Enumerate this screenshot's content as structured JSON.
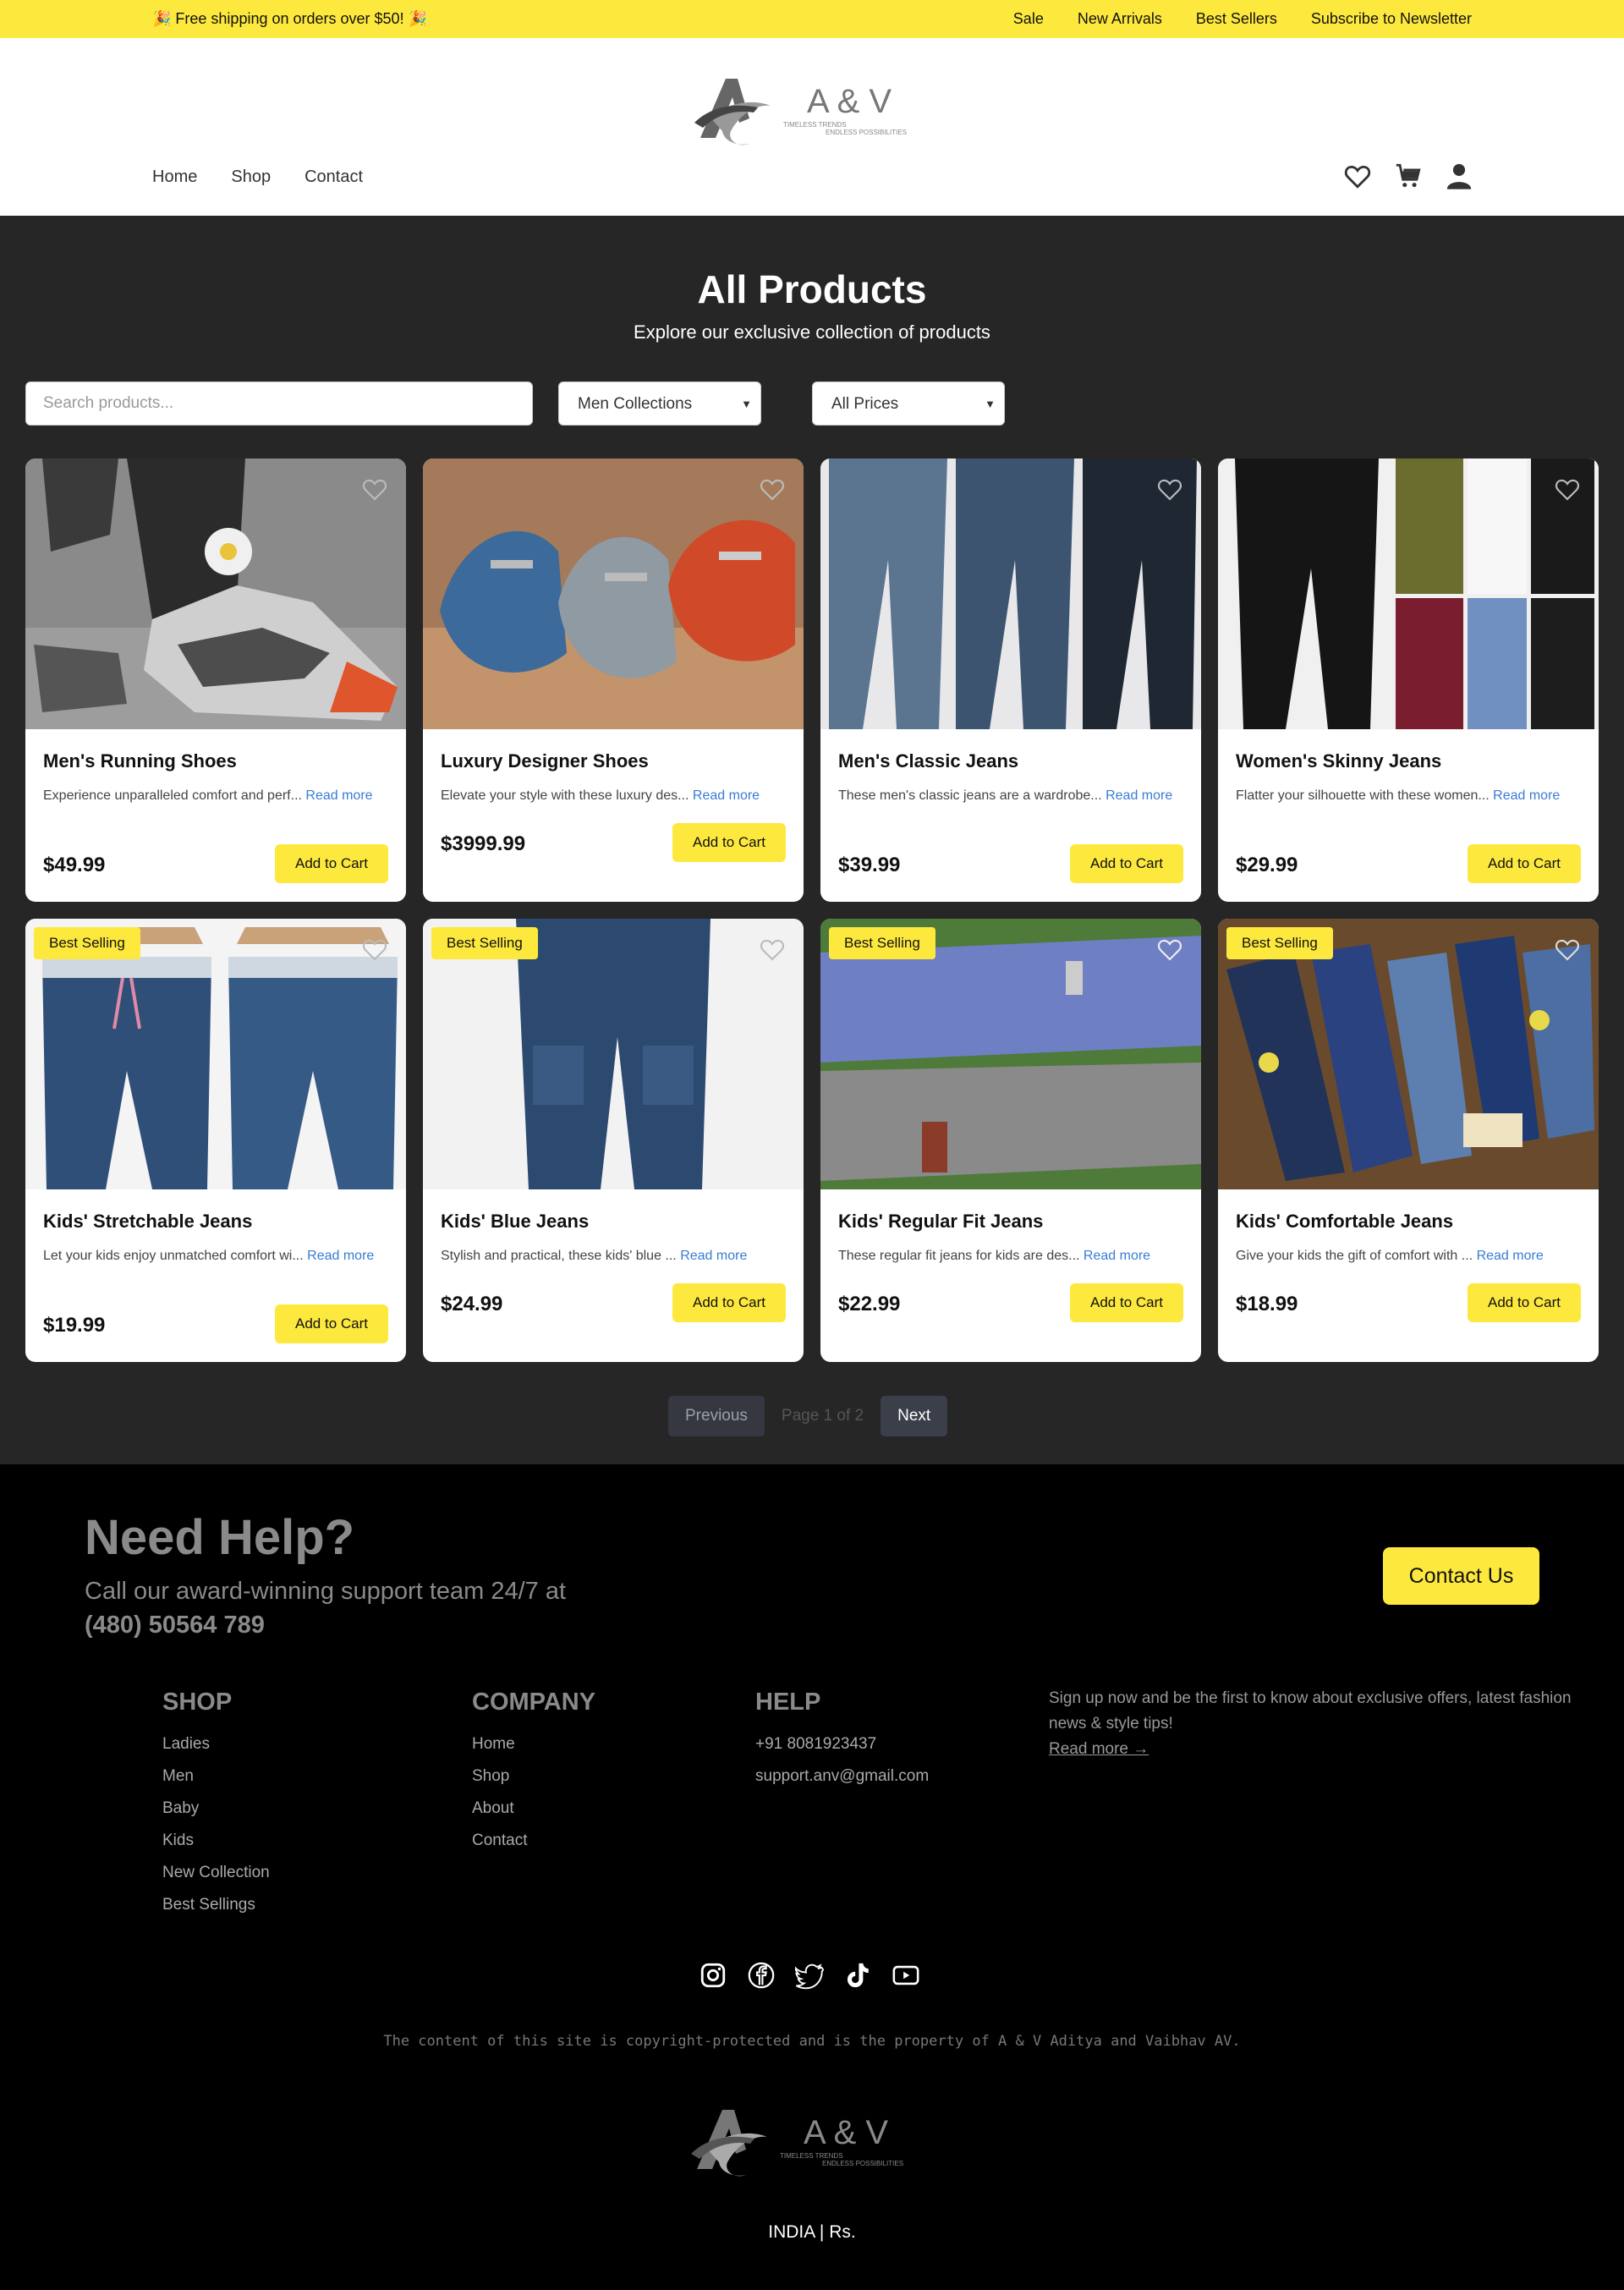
{
  "topbar": {
    "promo": "🎉 Free shipping on orders over $50! 🎉",
    "links": [
      "Sale",
      "New Arrivals",
      "Best Sellers",
      "Subscribe to Newsletter"
    ]
  },
  "header": {
    "logo_text": "A & V",
    "logo_tagline_1": "TIMELESS TRENDS",
    "logo_tagline_2": "ENDLESS POSSIBILITIES",
    "nav": [
      "Home",
      "Shop",
      "Contact"
    ],
    "icons": [
      "heart-icon",
      "cart-icon",
      "user-icon"
    ]
  },
  "main": {
    "title": "All Products",
    "subtitle": "Explore our exclusive collection of products",
    "search_placeholder": "Search products...",
    "category_filter": "Men Collections",
    "price_filter": "All Prices",
    "add_to_cart_label": "Add to Cart",
    "read_more_label": "Read more",
    "badge_label": "Best Selling",
    "products": [
      {
        "name": "Men's Running Shoes",
        "desc": "Experience unparalleled comfort and perf...",
        "price": "$49.99",
        "badge": false
      },
      {
        "name": "Luxury Designer Shoes",
        "desc": "Elevate your style with these luxury des...",
        "price": "$3999.99",
        "badge": false
      },
      {
        "name": "Men's Classic Jeans",
        "desc": "These men's classic jeans are a wardrobe...",
        "price": "$39.99",
        "badge": false
      },
      {
        "name": "Women's Skinny Jeans",
        "desc": "Flatter your silhouette with these women...",
        "price": "$29.99",
        "badge": false
      },
      {
        "name": "Kids' Stretchable Jeans",
        "desc": "Let your kids enjoy unmatched comfort wi...",
        "price": "$19.99",
        "badge": true
      },
      {
        "name": "Kids' Blue Jeans",
        "desc": "Stylish and practical, these kids' blue ...",
        "price": "$24.99",
        "badge": true
      },
      {
        "name": "Kids' Regular Fit Jeans",
        "desc": "These regular fit jeans for kids are des...",
        "price": "$22.99",
        "badge": true
      },
      {
        "name": "Kids' Comfortable Jeans",
        "desc": "Give your kids the gift of comfort with ...",
        "price": "$18.99",
        "badge": true
      }
    ],
    "pagination": {
      "prev": "Previous",
      "info": "Page 1 of 2",
      "next": "Next"
    }
  },
  "footer": {
    "help_title": "Need Help?",
    "help_text": "Call our award-winning support team 24/7 at",
    "help_phone": "(480) 50564 789",
    "contact_button": "Contact Us",
    "shop": {
      "title": "SHOP",
      "items": [
        "Ladies",
        "Men",
        "Baby",
        "Kids",
        "New Collection",
        "Best Sellings"
      ]
    },
    "company": {
      "title": "COMPANY",
      "items": [
        "Home",
        "Shop",
        "About",
        "Contact"
      ]
    },
    "help": {
      "title": "HELP",
      "items": [
        "+91 8081923437",
        "support.anv@gmail.com"
      ]
    },
    "newsletter_text": "Sign up now and be the first to know about exclusive offers, latest fashion news & style tips!",
    "newsletter_link": "Read more →",
    "socials": [
      "instagram-icon",
      "facebook-icon",
      "twitter-icon",
      "tiktok-icon",
      "youtube-icon"
    ],
    "copyright": "The content of this site is copyright-protected and is the property of A & V Aditya and Vaibhav AV.",
    "locale": "INDIA | Rs."
  },
  "colors": {
    "accent": "#fde93d",
    "dark_bg": "#262626",
    "footer_bg": "#000000",
    "link": "#3a7bd5"
  }
}
